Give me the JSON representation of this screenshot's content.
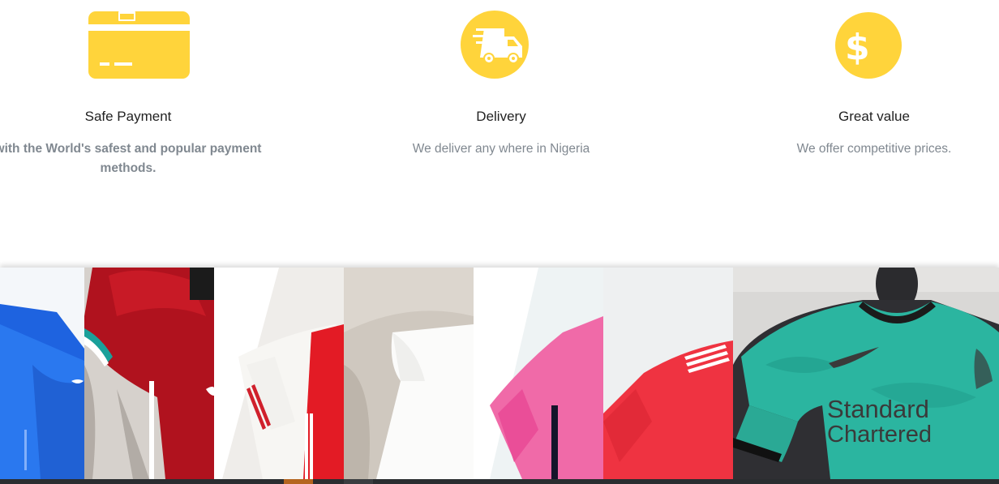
{
  "features": [
    {
      "icon": "credit-card-icon",
      "title": "Safe Payment",
      "description": "with the World's safest and popular payment methods."
    },
    {
      "icon": "delivery-truck-icon",
      "title": "Delivery",
      "description": "We deliver any where in Nigeria"
    },
    {
      "icon": "dollar-coin-icon",
      "title": "Great value",
      "description": "We offer competitive prices."
    }
  ],
  "gallery": {
    "images": [
      {
        "name": "blue-jersey-image"
      },
      {
        "name": "red-jersey-image"
      },
      {
        "name": "red-white-jersey-image"
      },
      {
        "name": "white-shirt-on-rug-image"
      },
      {
        "name": "pink-jersey-image"
      },
      {
        "name": "red-adidas-jersey-image"
      },
      {
        "name": "teal-liverpool-jersey-image",
        "print_1": "Standard",
        "print_2": "Chartered"
      }
    ]
  },
  "colors": {
    "icon_yellow": "#FFD43B",
    "title_text": "#222222",
    "desc_text": "#808890",
    "bottom_bar": "#2A2D30",
    "bottom_bar_accent": "#B4651F"
  }
}
